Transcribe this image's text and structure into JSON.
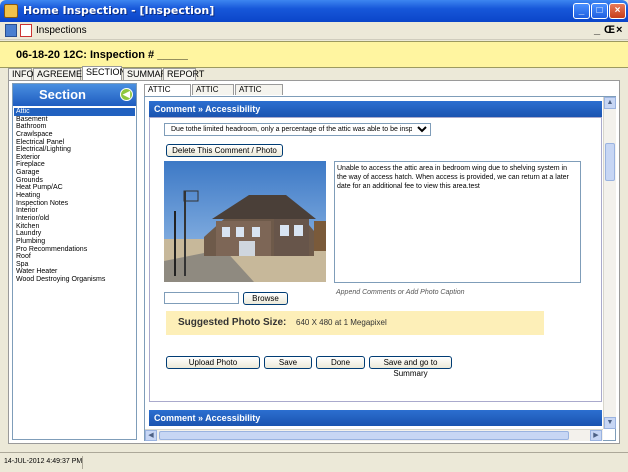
{
  "window": {
    "title": "Home Inspection - [Inspection]",
    "min": "_",
    "max": "□",
    "close": "×"
  },
  "mdi": {
    "label": "Inspections",
    "min": "_",
    "restore": "Œ",
    "close": "×"
  },
  "header": {
    "text": "06-18-20 12C: Inspection # _____"
  },
  "main_tabs": [
    "INFO",
    "AGREEMENT",
    "SECTIONS",
    "SUMMARY",
    "REPORT"
  ],
  "active_main_tab": "SECTIONS",
  "section": {
    "title": "Section",
    "icon": "back-arrow-icon"
  },
  "sections": [
    "Attic",
    "Basement",
    "Bathroom",
    "Crawlspace",
    "Electrical Panel",
    "Electrical/Lighting",
    "Exterior",
    "Fireplace",
    "Garage",
    "Grounds",
    "Heat Pump/AC",
    "Heating",
    "Inspection Notes",
    "Interior",
    "Interior/old",
    "Kitchen",
    "Laundry",
    "Plumbing",
    "Pro Recommendations",
    "Roof",
    "Spa",
    "Water Heater",
    "Wood Destroying Organisms"
  ],
  "selected_section": "Attic",
  "sub_tabs": [
    "ATTIC ITEMS",
    "ATTIC INFO",
    "ATTIC NOTES"
  ],
  "active_sub_tab": "ATTIC ITEMS",
  "comment": {
    "header": "Comment » Accessibility",
    "dropdown_value": "Due tothe limited headroom, only a percentage of the attic was able to be insp...",
    "delete_label": "Delete This Comment / Photo",
    "caption_text": "Unable to access the attic area in bedroom wing due to shelving system in the way of access hatch. When access is provided, we can return at a later date for an additional fee to view this area.test",
    "caption_hint": "Append Comments or Add Photo Caption",
    "browse_label": "Browse",
    "file_value": "",
    "suggest_label": "Suggested Photo Size:",
    "suggest_value": "640 X 480 at 1 Megapixel",
    "upload_label": "Upload Photo",
    "save_label": "Save",
    "done_label": "Done",
    "save_summary_label": "Save and go to Summary"
  },
  "comment2": {
    "header": "Comment » Accessibility"
  },
  "status": {
    "timestamp": "14-JUL-2012  4:49:37 PM"
  },
  "colors": {
    "titlebar": "#0b45c9",
    "header_band": "#fff5a0",
    "section_head": "#1e5cc0",
    "selected": "#2161c0",
    "suggest_bg": "#fdefb8"
  }
}
